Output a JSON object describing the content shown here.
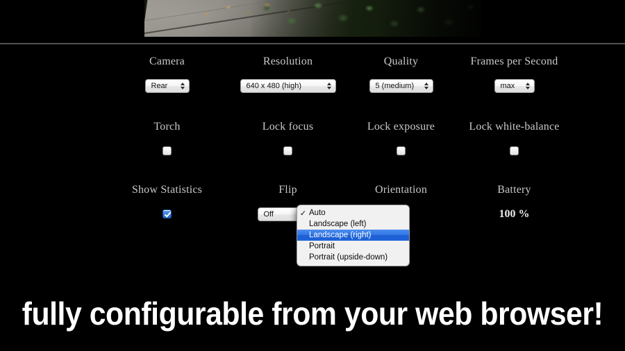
{
  "preview": {
    "alt": "live camera preview showing pavement and green ivy"
  },
  "rows": [
    {
      "id": "capture-settings",
      "controls": [
        {
          "label": "Camera",
          "type": "select",
          "value": "Rear"
        },
        {
          "label": "Resolution",
          "type": "select",
          "value": "640 x 480 (high)"
        },
        {
          "label": "Quality",
          "type": "select",
          "value": "5 (medium)"
        },
        {
          "label": "Frames per Second",
          "type": "select",
          "value": "max"
        }
      ]
    },
    {
      "id": "locks",
      "controls": [
        {
          "label": "Torch",
          "type": "checkbox",
          "checked": false
        },
        {
          "label": "Lock focus",
          "type": "checkbox",
          "checked": false
        },
        {
          "label": "Lock exposure",
          "type": "checkbox",
          "checked": false
        },
        {
          "label": "Lock white-balance",
          "type": "checkbox",
          "checked": false
        }
      ]
    },
    {
      "id": "display",
      "controls": [
        {
          "label": "Show Statistics",
          "type": "checkbox",
          "checked": true
        },
        {
          "label": "Flip",
          "type": "select",
          "value": "Off"
        },
        {
          "label": "Orientation",
          "type": "select",
          "value": "Auto"
        },
        {
          "label": "Battery",
          "type": "text",
          "value": "100 %"
        }
      ]
    }
  ],
  "orientation_menu": {
    "open": true,
    "items": [
      {
        "label": "Auto",
        "checked": true,
        "highlighted": false
      },
      {
        "label": "Landscape (left)",
        "checked": false,
        "highlighted": false
      },
      {
        "label": "Landscape (right)",
        "checked": false,
        "highlighted": true
      },
      {
        "label": "Portrait",
        "checked": false,
        "highlighted": false
      },
      {
        "label": "Portrait (upside-down)",
        "checked": false,
        "highlighted": false
      }
    ],
    "checkmark_glyph": "✓",
    "highlight_color": "#2f74e3"
  },
  "caption": {
    "text": "fully configurable from your web browser!"
  },
  "colors": {
    "background": "#000000",
    "label_text": "#c9c9c9",
    "caption_text": "#ffffff",
    "divider": "#6a6a6a",
    "accent_blue": "#1d62cf"
  }
}
